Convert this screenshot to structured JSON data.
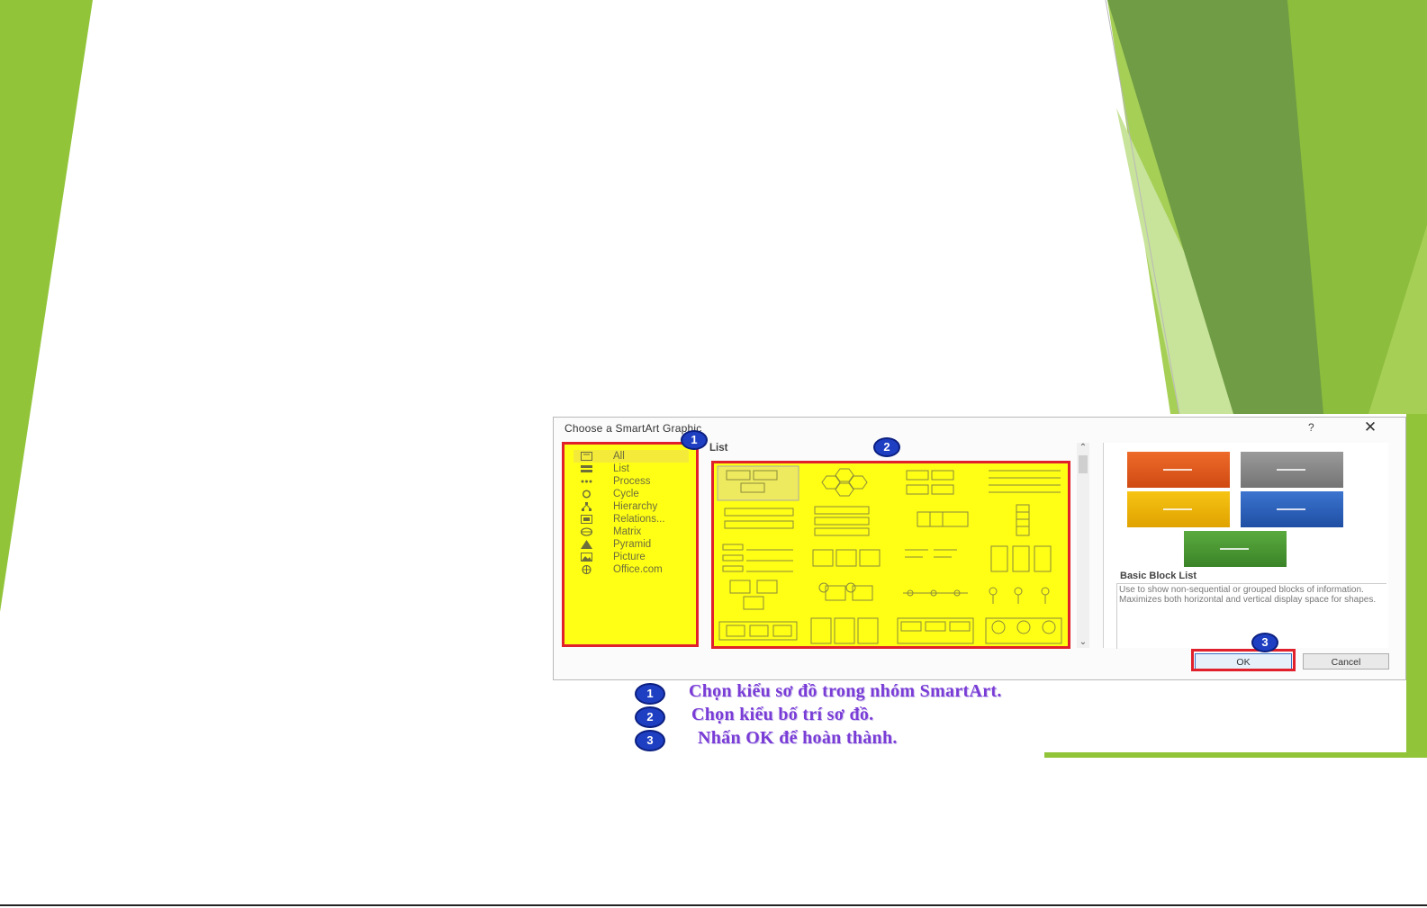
{
  "dialog": {
    "title": "Choose a SmartArt Graphic",
    "help_label": "?",
    "close_label": "✕",
    "categories": [
      {
        "label": "All",
        "selected": true
      },
      {
        "label": "List"
      },
      {
        "label": "Process"
      },
      {
        "label": "Cycle"
      },
      {
        "label": "Hierarchy"
      },
      {
        "label": "Relations..."
      },
      {
        "label": "Matrix"
      },
      {
        "label": "Pyramid"
      },
      {
        "label": "Picture"
      },
      {
        "label": "Office.com"
      }
    ],
    "layout_group_label": "List",
    "preview": {
      "name": "Basic Block List",
      "description": "Use to show non-sequential or grouped blocks of information. Maximizes both horizontal and vertical display space for shapes.",
      "colors": [
        "#e2571b",
        "#8a8a8a",
        "#f2b400",
        "#2d62bd",
        "#4a9a32"
      ]
    },
    "ok_label": "OK",
    "cancel_label": "Cancel"
  },
  "badges": {
    "one": "1",
    "two": "2",
    "three": "3"
  },
  "steps": [
    {
      "number": "1",
      "text": "Chọn kiểu sơ đồ trong nhóm SmartArt."
    },
    {
      "number": "2",
      "text": "Chọn kiểu bố trí sơ đồ."
    },
    {
      "number": "3",
      "text": "Nhấn OK để hoàn thành."
    }
  ],
  "colors": {
    "highlight": "#ffff16",
    "frame": "#e0202a",
    "badge": "#1f3fc2",
    "green_dark": "#5f9236",
    "green_light": "#92c43a"
  }
}
